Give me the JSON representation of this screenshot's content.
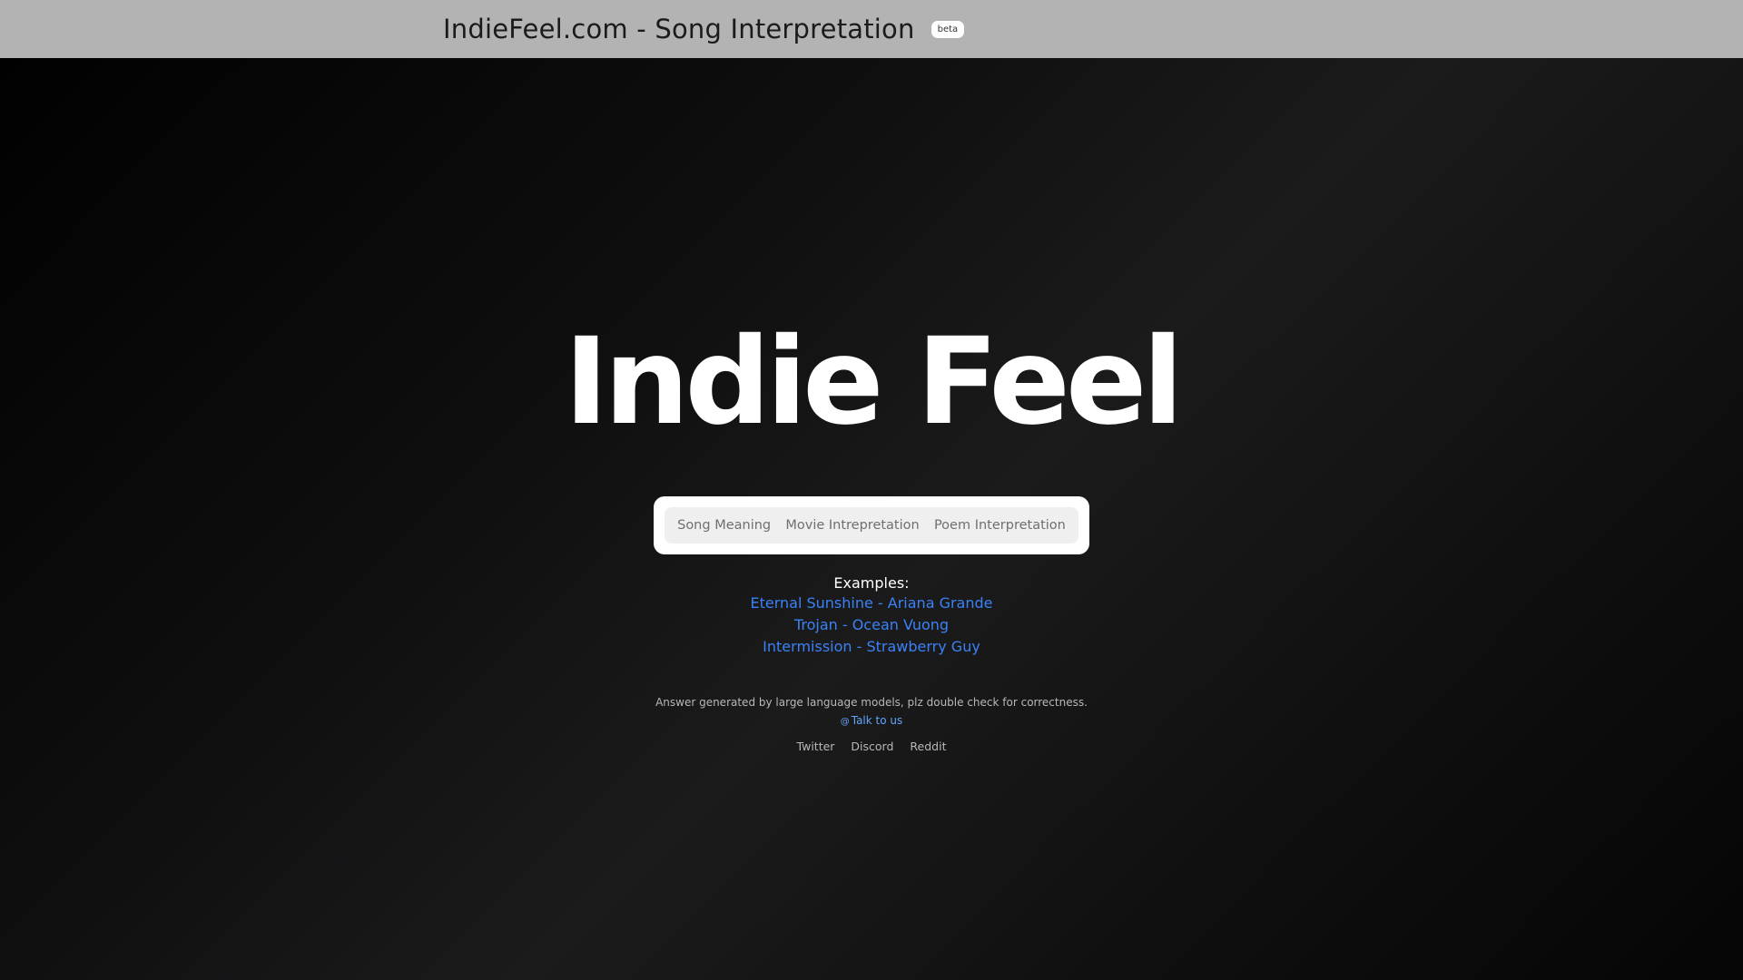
{
  "header": {
    "title": "IndieFeel.com - Song Interpretation",
    "badge": "beta"
  },
  "hero": {
    "brand": "Indie Feel"
  },
  "tabs": [
    {
      "label": "Song Meaning"
    },
    {
      "label": "Movie Intrepretation"
    },
    {
      "label": "Poem Interpretation"
    }
  ],
  "examples": {
    "label": "Examples:",
    "items": [
      "Eternal Sunshine - Ariana Grande",
      "Trojan - Ocean Vuong",
      "Intermission - Strawberry Guy"
    ]
  },
  "footer": {
    "disclaimer": "Answer generated by large language models, plz double check for correctness.",
    "contact_icon": "at-icon",
    "contact_label": "Talk to us",
    "links": [
      "Twitter",
      "Discord",
      "Reddit"
    ]
  },
  "colors": {
    "link": "#3b82f6",
    "topbar": "#b3b3b3"
  }
}
